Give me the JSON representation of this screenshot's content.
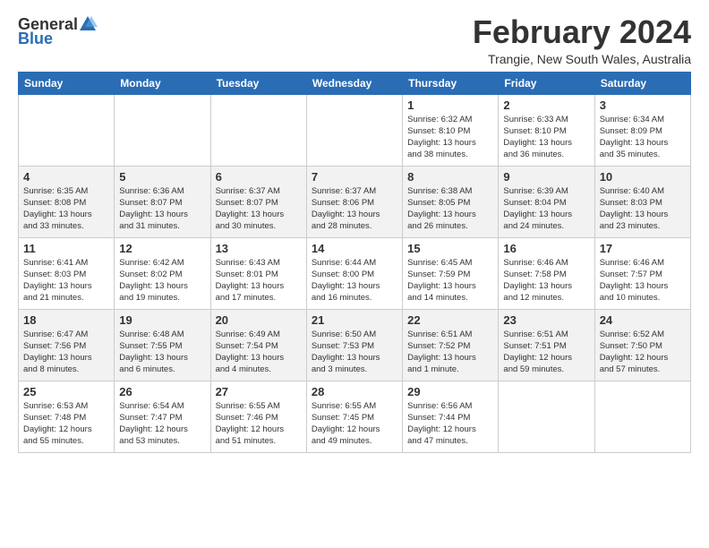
{
  "logo": {
    "general": "General",
    "blue": "Blue"
  },
  "title": "February 2024",
  "location": "Trangie, New South Wales, Australia",
  "days_of_week": [
    "Sunday",
    "Monday",
    "Tuesday",
    "Wednesday",
    "Thursday",
    "Friday",
    "Saturday"
  ],
  "weeks": [
    [
      {
        "day": "",
        "info": ""
      },
      {
        "day": "",
        "info": ""
      },
      {
        "day": "",
        "info": ""
      },
      {
        "day": "",
        "info": ""
      },
      {
        "day": "1",
        "info": "Sunrise: 6:32 AM\nSunset: 8:10 PM\nDaylight: 13 hours\nand 38 minutes."
      },
      {
        "day": "2",
        "info": "Sunrise: 6:33 AM\nSunset: 8:10 PM\nDaylight: 13 hours\nand 36 minutes."
      },
      {
        "day": "3",
        "info": "Sunrise: 6:34 AM\nSunset: 8:09 PM\nDaylight: 13 hours\nand 35 minutes."
      }
    ],
    [
      {
        "day": "4",
        "info": "Sunrise: 6:35 AM\nSunset: 8:08 PM\nDaylight: 13 hours\nand 33 minutes."
      },
      {
        "day": "5",
        "info": "Sunrise: 6:36 AM\nSunset: 8:07 PM\nDaylight: 13 hours\nand 31 minutes."
      },
      {
        "day": "6",
        "info": "Sunrise: 6:37 AM\nSunset: 8:07 PM\nDaylight: 13 hours\nand 30 minutes."
      },
      {
        "day": "7",
        "info": "Sunrise: 6:37 AM\nSunset: 8:06 PM\nDaylight: 13 hours\nand 28 minutes."
      },
      {
        "day": "8",
        "info": "Sunrise: 6:38 AM\nSunset: 8:05 PM\nDaylight: 13 hours\nand 26 minutes."
      },
      {
        "day": "9",
        "info": "Sunrise: 6:39 AM\nSunset: 8:04 PM\nDaylight: 13 hours\nand 24 minutes."
      },
      {
        "day": "10",
        "info": "Sunrise: 6:40 AM\nSunset: 8:03 PM\nDaylight: 13 hours\nand 23 minutes."
      }
    ],
    [
      {
        "day": "11",
        "info": "Sunrise: 6:41 AM\nSunset: 8:03 PM\nDaylight: 13 hours\nand 21 minutes."
      },
      {
        "day": "12",
        "info": "Sunrise: 6:42 AM\nSunset: 8:02 PM\nDaylight: 13 hours\nand 19 minutes."
      },
      {
        "day": "13",
        "info": "Sunrise: 6:43 AM\nSunset: 8:01 PM\nDaylight: 13 hours\nand 17 minutes."
      },
      {
        "day": "14",
        "info": "Sunrise: 6:44 AM\nSunset: 8:00 PM\nDaylight: 13 hours\nand 16 minutes."
      },
      {
        "day": "15",
        "info": "Sunrise: 6:45 AM\nSunset: 7:59 PM\nDaylight: 13 hours\nand 14 minutes."
      },
      {
        "day": "16",
        "info": "Sunrise: 6:46 AM\nSunset: 7:58 PM\nDaylight: 13 hours\nand 12 minutes."
      },
      {
        "day": "17",
        "info": "Sunrise: 6:46 AM\nSunset: 7:57 PM\nDaylight: 13 hours\nand 10 minutes."
      }
    ],
    [
      {
        "day": "18",
        "info": "Sunrise: 6:47 AM\nSunset: 7:56 PM\nDaylight: 13 hours\nand 8 minutes."
      },
      {
        "day": "19",
        "info": "Sunrise: 6:48 AM\nSunset: 7:55 PM\nDaylight: 13 hours\nand 6 minutes."
      },
      {
        "day": "20",
        "info": "Sunrise: 6:49 AM\nSunset: 7:54 PM\nDaylight: 13 hours\nand 4 minutes."
      },
      {
        "day": "21",
        "info": "Sunrise: 6:50 AM\nSunset: 7:53 PM\nDaylight: 13 hours\nand 3 minutes."
      },
      {
        "day": "22",
        "info": "Sunrise: 6:51 AM\nSunset: 7:52 PM\nDaylight: 13 hours\nand 1 minute."
      },
      {
        "day": "23",
        "info": "Sunrise: 6:51 AM\nSunset: 7:51 PM\nDaylight: 12 hours\nand 59 minutes."
      },
      {
        "day": "24",
        "info": "Sunrise: 6:52 AM\nSunset: 7:50 PM\nDaylight: 12 hours\nand 57 minutes."
      }
    ],
    [
      {
        "day": "25",
        "info": "Sunrise: 6:53 AM\nSunset: 7:48 PM\nDaylight: 12 hours\nand 55 minutes."
      },
      {
        "day": "26",
        "info": "Sunrise: 6:54 AM\nSunset: 7:47 PM\nDaylight: 12 hours\nand 53 minutes."
      },
      {
        "day": "27",
        "info": "Sunrise: 6:55 AM\nSunset: 7:46 PM\nDaylight: 12 hours\nand 51 minutes."
      },
      {
        "day": "28",
        "info": "Sunrise: 6:55 AM\nSunset: 7:45 PM\nDaylight: 12 hours\nand 49 minutes."
      },
      {
        "day": "29",
        "info": "Sunrise: 6:56 AM\nSunset: 7:44 PM\nDaylight: 12 hours\nand 47 minutes."
      },
      {
        "day": "",
        "info": ""
      },
      {
        "day": "",
        "info": ""
      }
    ]
  ]
}
